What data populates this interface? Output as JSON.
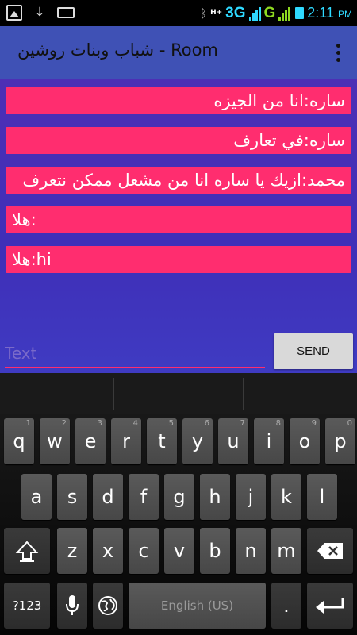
{
  "status_bar": {
    "network_primary": "3G",
    "network_secondary": "G",
    "network_hplus": "H+",
    "time": "2:11",
    "ampm": "PM",
    "icons": [
      "image-icon",
      "download-icon",
      "keyboard-icon",
      "bluetooth-icon",
      "signal-icon",
      "battery-icon"
    ]
  },
  "app_bar": {
    "title": "شباب وبنات روشين - Room",
    "menu_icon": "overflow-menu-icon"
  },
  "messages": [
    {
      "text": "ساره:انا من الجيزه"
    },
    {
      "text": "ساره:في تعارف"
    },
    {
      "text": "محمد:ازيك يا ساره انا من مشعل ممكن نتعرف"
    },
    {
      "text": "هلا:"
    },
    {
      "text": "هلا:hi"
    }
  ],
  "composer": {
    "placeholder": "Text",
    "value": "",
    "send_label": "SEND"
  },
  "keyboard": {
    "row1": [
      {
        "k": "q",
        "h": "1"
      },
      {
        "k": "w",
        "h": "2"
      },
      {
        "k": "e",
        "h": "3"
      },
      {
        "k": "r",
        "h": "4"
      },
      {
        "k": "t",
        "h": "5"
      },
      {
        "k": "y",
        "h": "6"
      },
      {
        "k": "u",
        "h": "7"
      },
      {
        "k": "i",
        "h": "8"
      },
      {
        "k": "o",
        "h": "9"
      },
      {
        "k": "p",
        "h": "0"
      }
    ],
    "row2": [
      "a",
      "s",
      "d",
      "f",
      "g",
      "h",
      "j",
      "k",
      "l"
    ],
    "row3": [
      "z",
      "x",
      "c",
      "v",
      "b",
      "n",
      "m"
    ],
    "symbols_label": "?123",
    "space_label": "English (US)",
    "period_label": ".",
    "colors": {
      "key": "#4f4f4f",
      "accent": "#ff2d6f",
      "chat_bg": "#4330b6",
      "app_bar": "#3f51b5"
    }
  }
}
